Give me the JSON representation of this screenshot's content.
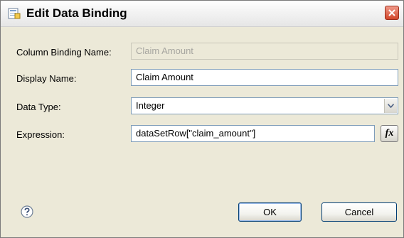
{
  "dialog": {
    "title": "Edit Data Binding",
    "icons": {
      "title": "data-binding-icon",
      "close": "close-icon",
      "help": "help-icon",
      "expression_builder": "fx-icon"
    }
  },
  "form": {
    "column_binding_name": {
      "label": "Column Binding Name:",
      "value": "Claim Amount"
    },
    "display_name": {
      "label": "Display Name:",
      "value": "Claim Amount"
    },
    "data_type": {
      "label": "Data Type:",
      "value": "Integer"
    },
    "expression": {
      "label": "Expression:",
      "value": "dataSetRow[\"claim_amount\"]",
      "button_label": "fx"
    }
  },
  "buttons": {
    "ok": "OK",
    "cancel": "Cancel"
  },
  "colors": {
    "dialog_bg": "#ece9d8",
    "field_border": "#7f9db9",
    "disabled_text": "#a7a6a0",
    "close_red": "#d2462a"
  }
}
